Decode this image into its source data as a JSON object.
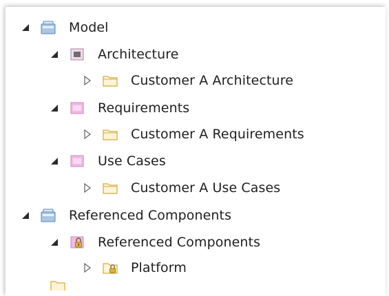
{
  "tree": {
    "items": [
      {
        "label": "Model",
        "icon": "model-package-icon",
        "expanded": true
      },
      {
        "label": "Architecture",
        "icon": "architecture-view-icon",
        "expanded": true
      },
      {
        "label": "Customer A Architecture",
        "icon": "folder-icon",
        "expanded": false
      },
      {
        "label": "Requirements",
        "icon": "requirements-view-icon",
        "expanded": true
      },
      {
        "label": "Customer A Requirements",
        "icon": "folder-icon",
        "expanded": false
      },
      {
        "label": "Use Cases",
        "icon": "use-cases-view-icon",
        "expanded": true
      },
      {
        "label": "Customer A Use Cases",
        "icon": "folder-icon",
        "expanded": false
      },
      {
        "label": "Referenced Components",
        "icon": "model-package-icon",
        "expanded": true
      },
      {
        "label": "Referenced Components",
        "icon": "locked-view-icon",
        "expanded": true
      },
      {
        "label": "Platform",
        "icon": "locked-folder-icon",
        "expanded": false
      }
    ]
  },
  "colors": {
    "folder_stroke": "#d6a93a",
    "folder_fill": "#fff5d6",
    "view_pink": "#f3b9e6",
    "view_stroke": "#c08fb6",
    "model_blue": "#a9c8e6",
    "model_stroke": "#5b84b1",
    "expanded_arrow": "#2a2a2a",
    "collapsed_arrow": "#6b6b6b"
  }
}
